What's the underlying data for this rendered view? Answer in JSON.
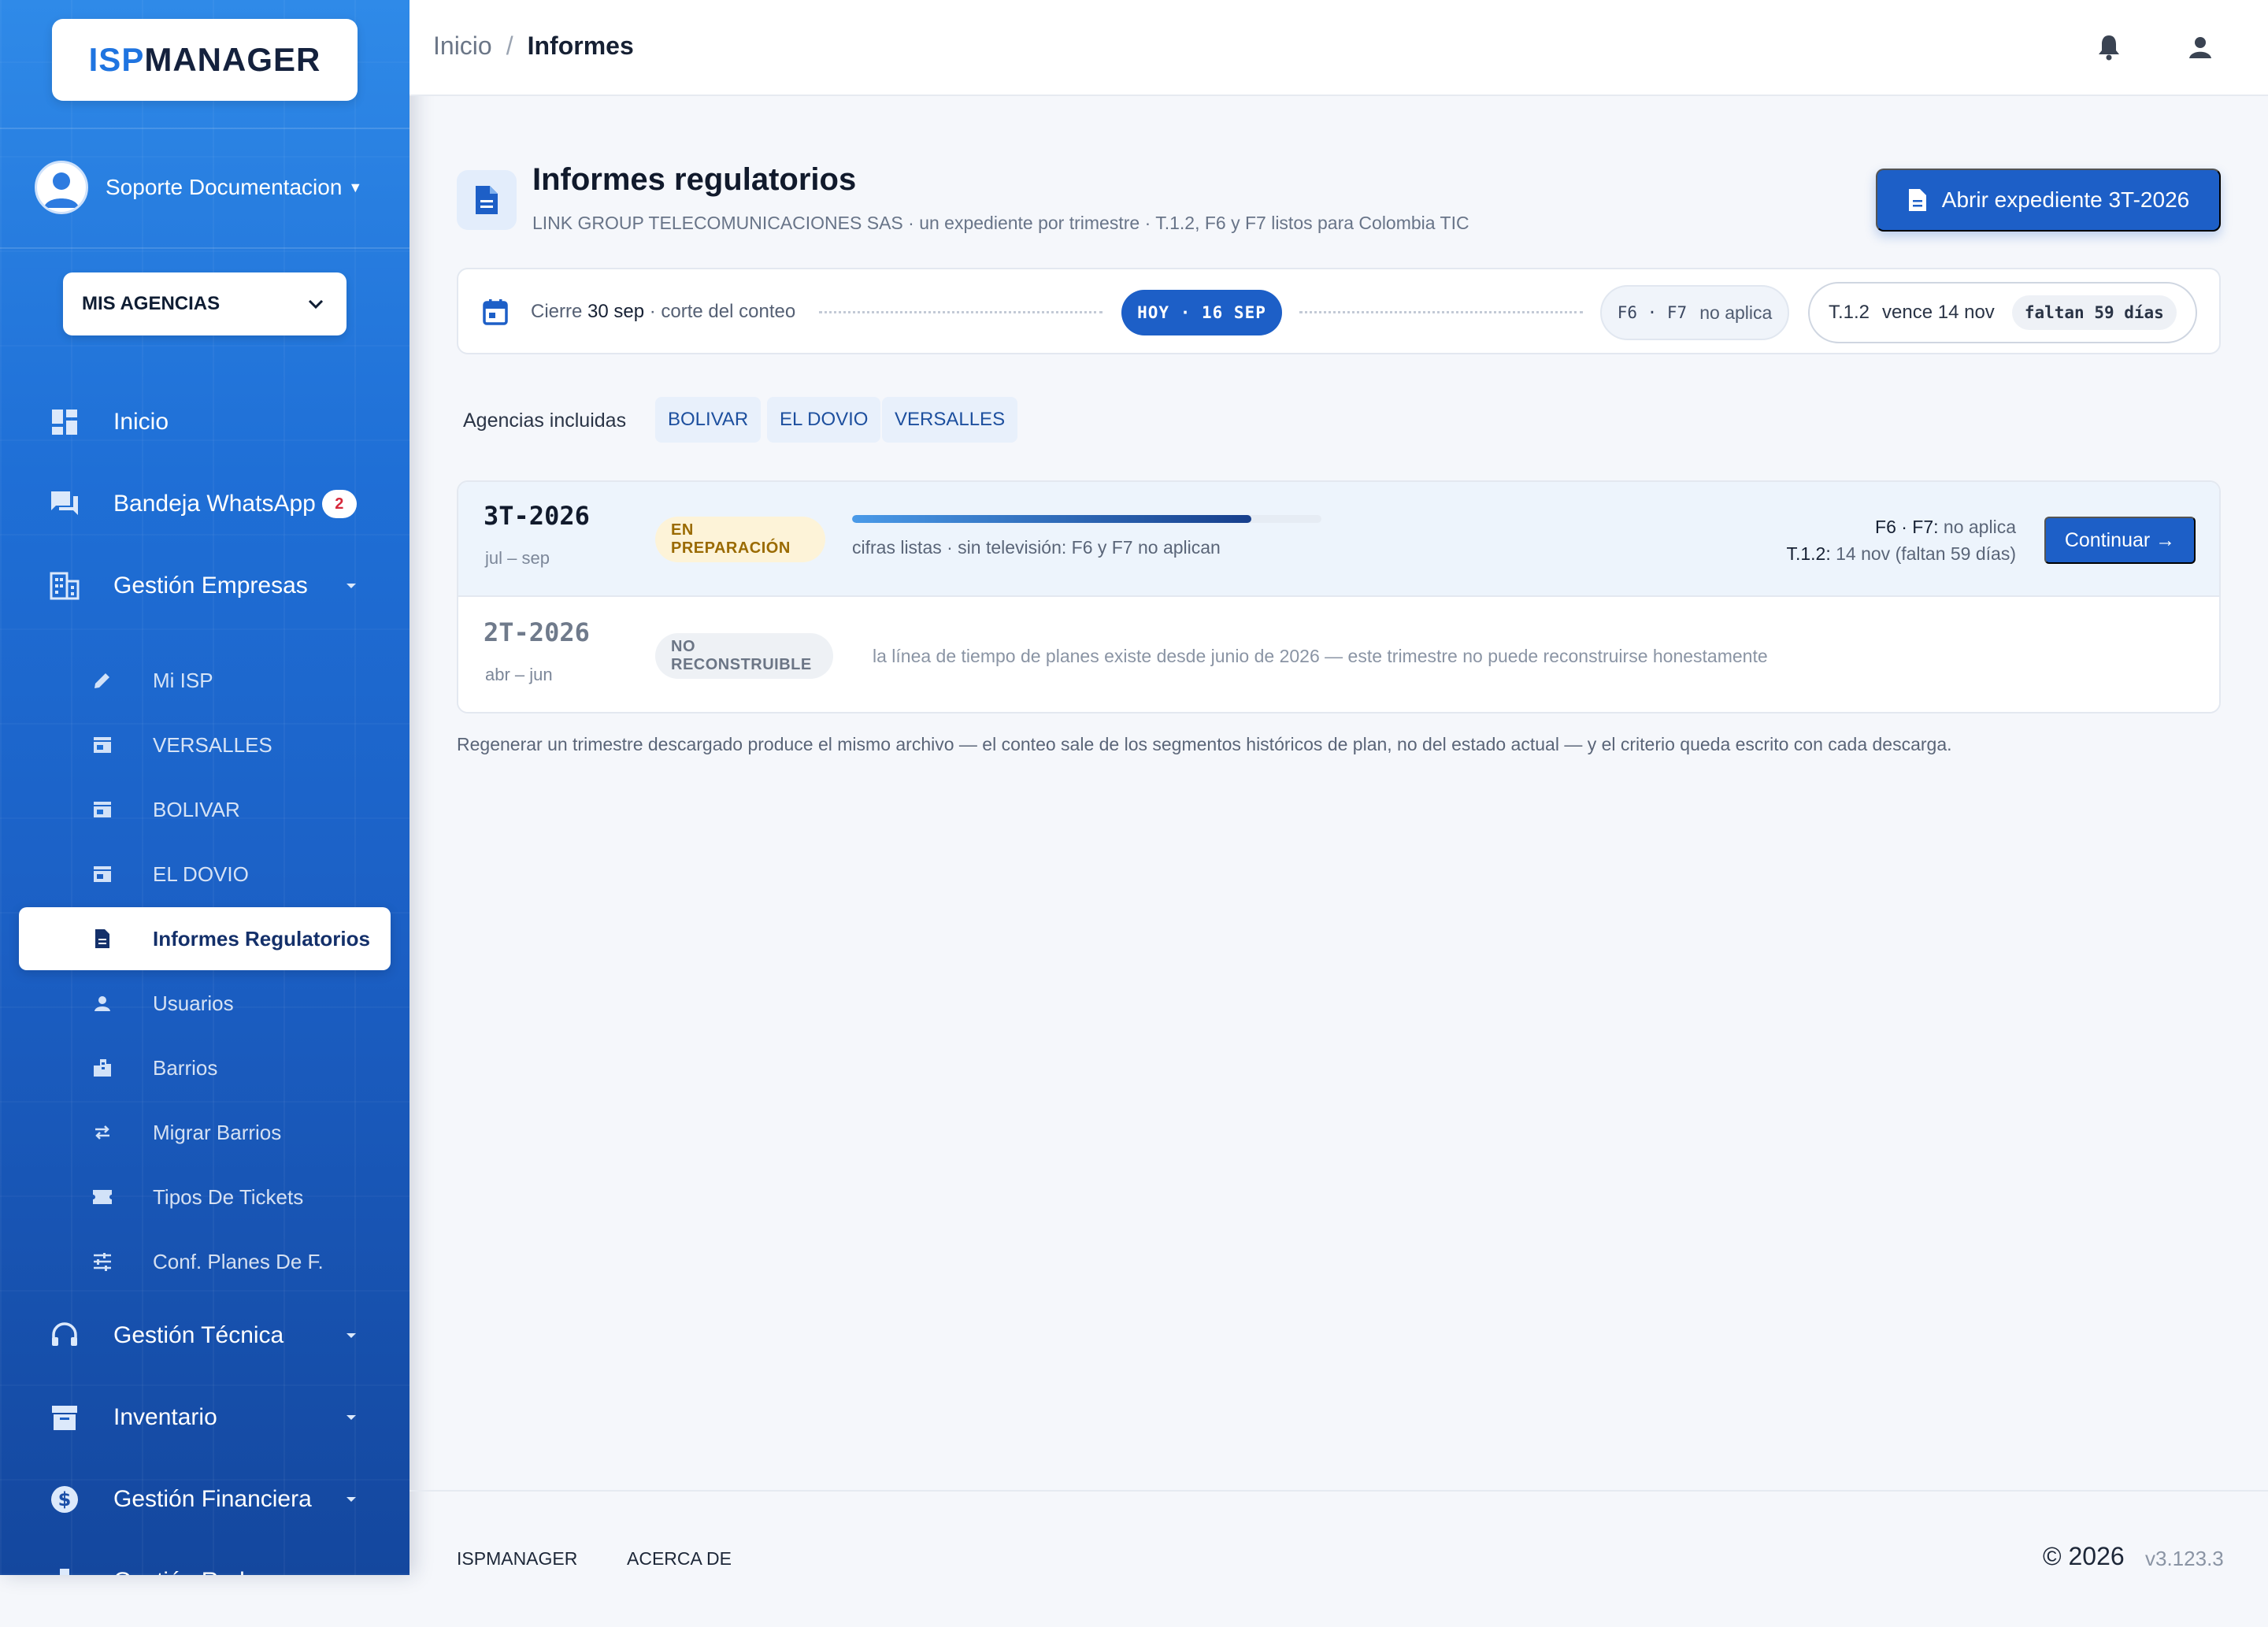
{
  "sidebar": {
    "logo_part1": "ISP",
    "logo_part2": "MANAGER",
    "user_name": "Soporte Documentacion",
    "agencies_label": "MIS AGENCIAS",
    "nav": {
      "inicio": "Inicio",
      "bandeja": "Bandeja WhatsApp",
      "bandeja_badge": "2",
      "gestion_empresas": "Gestión Empresas",
      "gestion_tecnica": "Gestión Técnica",
      "inventario": "Inventario",
      "gestion_financiera": "Gestión Financiera",
      "gestion_red": "Gestión Red"
    },
    "sub": {
      "mi_isp": "Mi ISP",
      "versalles": "VERSALLES",
      "bolivar": "BOLIVAR",
      "el_dovio": "EL DOVIO",
      "informes": "Informes Regulatorios",
      "usuarios": "Usuarios",
      "barrios": "Barrios",
      "migrar": "Migrar Barrios",
      "tickets": "Tipos De Tickets",
      "conf_planes": "Conf. Planes De F."
    }
  },
  "topbar": {
    "crumb_home": "Inicio",
    "crumb_sep": "/",
    "crumb_current": "Informes"
  },
  "page": {
    "title": "Informes regulatorios",
    "subtitle": "LINK GROUP TELECOMUNICACIONES SAS · un expediente por trimestre · T.1.2, F6 y F7 listos para Colombia TIC",
    "open_button": "Abrir expediente 3T-2026"
  },
  "timeline": {
    "cierre_prefix": "Cierre",
    "cierre_date": "30 sep",
    "cierre_suffix": "· corte del conteo",
    "today": "HOY · 16 SEP",
    "f6f7_key": "F6 · F7",
    "f6f7_value": "no aplica",
    "t12_key": "T.1.2",
    "t12_value": "vence 14 nov",
    "t12_remaining": "faltan 59 días"
  },
  "agencies": {
    "label": "Agencias incluidas",
    "items": [
      "BOLIVAR",
      "EL DOVIO",
      "VERSALLES"
    ]
  },
  "quarters": [
    {
      "code": "3T-2026",
      "range": "jul – sep",
      "status": "EN PREPARACIÓN",
      "progress": 0.85,
      "description": "cifras listas · sin televisión: F6 y F7 no aplican",
      "right_line1_key": "F6 · F7:",
      "right_line1_value": "no aplica",
      "right_line2_key": "T.1.2:",
      "right_line2_value": "14 nov (faltan 59 días)",
      "action": "Continuar →"
    },
    {
      "code": "2T-2026",
      "range": "abr – jun",
      "status": "NO RECONSTRUIBLE",
      "description": "la línea de tiempo de planes existe desde junio de 2026 — este trimestre no puede reconstruirse honestamente"
    }
  ],
  "footnote": "Regenerar un trimestre descargado produce el mismo archivo — el conteo sale de los segmentos históricos de plan, no del estado actual — y el criterio queda escrito con cada descarga.",
  "footer": {
    "link1": "ISPMANAGER",
    "link2": "ACERCA DE",
    "copyright": "© 2026",
    "version": "v3.123.3"
  },
  "colors": {
    "primary": "#1d5fc7",
    "sidebar_top": "#2f8ae8",
    "sidebar_bottom": "#14479e",
    "prep_badge_bg": "#fdf3d8",
    "prep_badge_text": "#9a6a00"
  }
}
